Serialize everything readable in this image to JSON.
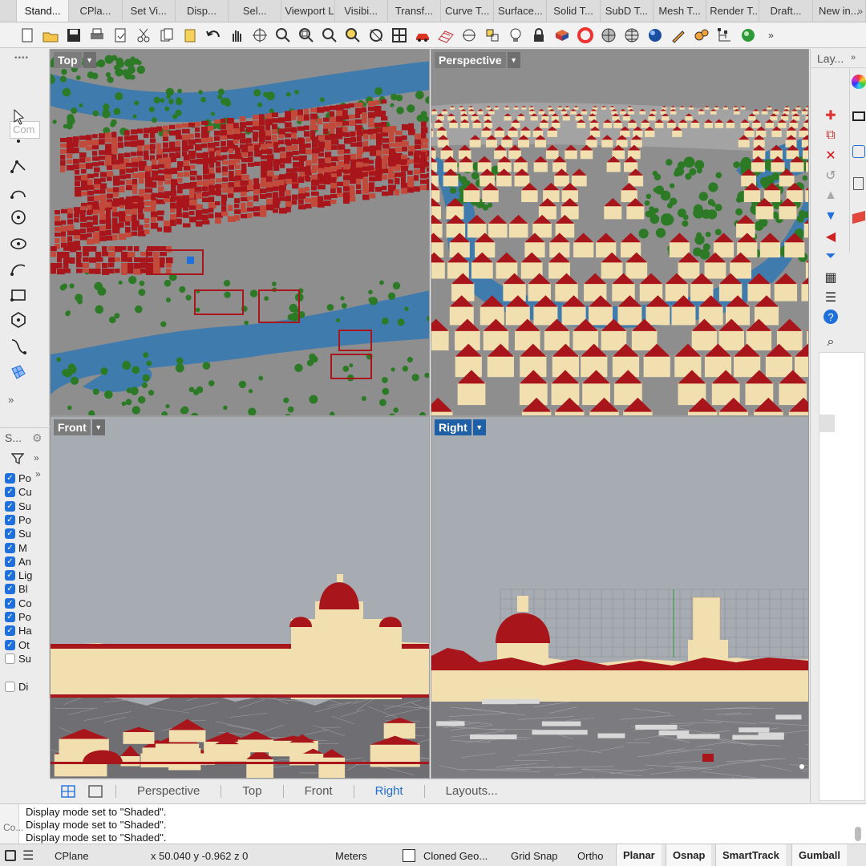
{
  "tabs": [
    "Stand...",
    "CPla...",
    "Set Vi...",
    "Disp...",
    "Sel...",
    "Viewport L...",
    "Visibi...",
    "Transf...",
    "Curve T...",
    "Surface...",
    "Solid T...",
    "SubD T...",
    "Mesh T...",
    "Render T...",
    "Draft...",
    "New in..."
  ],
  "tab_more": "»",
  "toolbar_icons": [
    "new-file-icon",
    "open-folder-icon",
    "save-icon",
    "print-icon",
    "import-icon",
    "cut-icon",
    "copy-icon",
    "paste-icon",
    "undo-icon",
    "pan-hand-icon",
    "rotate-view-icon",
    "zoom-icon",
    "zoom-window-icon",
    "zoom-extents-icon",
    "zoom-selected-icon",
    "undo-view-icon",
    "four-viewports-icon",
    "car-icon",
    "grid-icon",
    "cplane-icon",
    "light-icon",
    "lightbulb-icon",
    "lock-icon",
    "material-icon",
    "color-wheel-icon",
    "shaded-sphere-icon",
    "wireframe-sphere-icon",
    "rendered-sphere-icon",
    "pen-icon",
    "settings-gears-icon",
    "network-icon",
    "globe-icon"
  ],
  "toolbar_more": "»",
  "left": {
    "command_placeholder": "Com",
    "tools": [
      "select-arrow-icon",
      "point-icon",
      "polyline-icon",
      "curve-icon",
      "circle-icon",
      "ellipse-icon",
      "arc-icon",
      "rectangle-icon",
      "polygon-icon",
      "freeform-curve-icon",
      "surface-icon"
    ],
    "more": "»"
  },
  "snap_panel": {
    "title": "S...",
    "more": "»",
    "items": [
      {
        "label": "Po",
        "checked": true
      },
      {
        "label": "Cu",
        "checked": true
      },
      {
        "label": "Su",
        "checked": true
      },
      {
        "label": "Po",
        "checked": true
      },
      {
        "label": "Su",
        "checked": true
      },
      {
        "label": "M",
        "checked": true
      },
      {
        "label": "An",
        "checked": true
      },
      {
        "label": "Lig",
        "checked": true
      },
      {
        "label": "Bl",
        "checked": true
      },
      {
        "label": "Co",
        "checked": true
      },
      {
        "label": "Po",
        "checked": true
      },
      {
        "label": "Ha",
        "checked": true
      },
      {
        "label": "Ot",
        "checked": true
      },
      {
        "label": "Su",
        "checked": false
      }
    ],
    "extra": {
      "label": "Di",
      "checked": false
    }
  },
  "viewports": {
    "top": {
      "name": "Top",
      "active": false
    },
    "perspective": {
      "name": "Perspective",
      "active": false
    },
    "front": {
      "name": "Front",
      "active": false
    },
    "right": {
      "name": "Right",
      "active": true
    }
  },
  "viewport_tabs": [
    "Perspective",
    "Top",
    "Front",
    "Right",
    "Layouts..."
  ],
  "viewport_tab_selected": "Right",
  "right_panel": {
    "title": "Lay...",
    "more": "»",
    "tools": [
      "new-layer-icon",
      "new-sublayer-icon",
      "delete-icon",
      "undo-icon",
      "move-up-icon",
      "move-down-icon",
      "move-left-icon",
      "filter-icon",
      "table-icon",
      "menu-icon",
      "help-icon",
      "search-icon"
    ]
  },
  "command_history": {
    "side_label": "Co...",
    "lines": [
      "Display mode set to \"Shaded\".",
      "Display mode set to \"Shaded\".",
      "Display mode set to \"Shaded\"."
    ]
  },
  "status": {
    "cplane": "CPlane",
    "coords": "x 50.040  y -0.962  z 0",
    "units": "Meters",
    "layer": "Cloned Geo...",
    "grid_snap": "Grid Snap",
    "ortho": "Ortho",
    "planar": "Planar",
    "osnap": "Osnap",
    "smarttrack": "SmartTrack",
    "gumball": "Gumball"
  },
  "colors": {
    "roof": "#a8161b",
    "wall": "#f2dfb0",
    "river": "#3f7cad",
    "trees": "#2c7a26",
    "ground": "#8e8e8e",
    "sky": "#a7abb2",
    "accent": "#1f6fdc"
  }
}
